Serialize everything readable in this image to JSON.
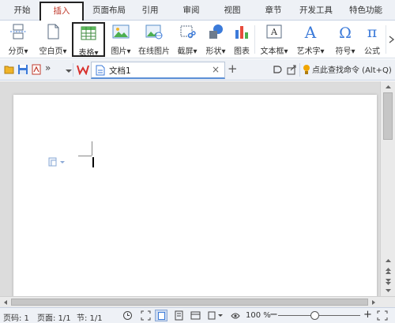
{
  "menu": {
    "tabs": [
      {
        "label": "开始"
      },
      {
        "label": "插入"
      },
      {
        "label": "页面布局"
      },
      {
        "label": "引用"
      },
      {
        "label": "审阅"
      },
      {
        "label": "视图"
      },
      {
        "label": "章节"
      },
      {
        "label": "开发工具"
      },
      {
        "label": "特色功能"
      }
    ],
    "active_index": 1
  },
  "ribbon": {
    "items": [
      {
        "label": "分页",
        "icon": "page-break-icon",
        "dropdown": true
      },
      {
        "label": "空白页",
        "icon": "blank-page-icon",
        "dropdown": true
      },
      {
        "label": "表格",
        "icon": "table-icon",
        "dropdown": true
      },
      {
        "label": "图片",
        "icon": "picture-icon",
        "dropdown": true
      },
      {
        "label": "在线图片",
        "icon": "online-picture-icon",
        "dropdown": false
      },
      {
        "label": "截屏",
        "icon": "screenshot-icon",
        "dropdown": true
      },
      {
        "label": "形状",
        "icon": "shapes-icon",
        "dropdown": true
      },
      {
        "label": "图表",
        "icon": "chart-icon",
        "dropdown": false
      },
      {
        "label": "文本框",
        "icon": "text-box-icon",
        "dropdown": true
      },
      {
        "label": "艺术字",
        "icon": "word-art-icon",
        "dropdown": true
      },
      {
        "label": "符号",
        "icon": "symbol-icon",
        "dropdown": true
      },
      {
        "label": "公式",
        "icon": "formula-icon",
        "dropdown": false
      }
    ],
    "selected": "表格",
    "dropdown_arrow": "▾"
  },
  "quickbar": {
    "document_tab": {
      "name": "文档1"
    },
    "close_glyph": "×",
    "new_tab_glyph": "+",
    "command_search": "点此查找命令 (Alt+Q)",
    "double_arrow": "»"
  },
  "status": {
    "page_no": "页码: 1",
    "pages": "页面: 1/1",
    "section": "节: 1/1",
    "zoom": "100 %",
    "zoom_fraction": 0.45,
    "zoom_minus": "−",
    "zoom_plus": "+"
  },
  "colors": {
    "accent_red": "#c0392b",
    "wps_red": "#d9302c",
    "tab_blue": "#5b8fd6"
  }
}
